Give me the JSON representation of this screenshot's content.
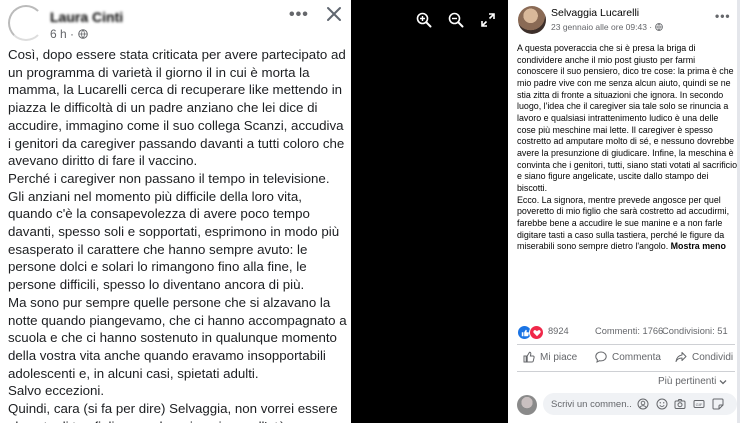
{
  "left_post": {
    "author": "Laura Cinti",
    "time": "6 h ·",
    "paragraphs": [
      "Così, dopo essere stata criticata per avere partecipato ad un programma di varietà il giorno il in cui è morta la mamma, la Lucarelli cerca di recuperare like mettendo in piazza le difficoltà di un padre anziano che lei dice di accudire, immagino come il suo collega Scanzi, accudiva i genitori da caregiver passando davanti a tutti coloro che avevano diritto di fare il vaccino.",
      "Perché i caregiver non passano il tempo in televisione.",
      "Gli anziani nel momento più difficile della loro vita, quando c'è la consapevolezza di avere poco tempo davanti, spesso soli e sopportati, esprimono in modo più esasperato il carattere che hanno sempre avuto: le persone dolci e solari lo rimangono fino alla fine, le persone difficili, spesso lo diventano ancora di più.",
      "Ma sono pur sempre quelle persone che si alzavano la notte quando piangevamo, che ci hanno accompagnato a scuola e che ci hanno sostenuto in qualunque momento della vostra vita anche quando eravamo insopportabili adolescenti e, in alcuni casi, spietati adulti.",
      "Salvo eccezioni.",
      "Quindi, cara (si fa per dire) Selvaggia, non vorrei essere al posto di tuo figlio quando arriverai a quell'età."
    ]
  },
  "right_panel": {
    "author": "Selvaggia Lucarelli",
    "date": "23 gennaio alle ore 09:43 ·",
    "paragraphs": [
      "A questa poveraccia che si è presa la briga di condividere anche il mio post giusto per farmi conoscere il suo pensiero, dico tre cose: la prima è che mio padre vive con me senza alcun aiuto, quindi se ne stia zitta di fronte a situazioni che ignora. In secondo luogo, l'idea che il caregiver sia tale solo se rinuncia a lavoro e qualsiasi intrattenimento ludico è una delle cose più meschine mai lette. Il caregiver è spesso costretto ad amputare molto di sé, e nessuno dovrebbe avere la presunzione di giudicare. Infine, la meschina è convinta che i genitori, tutti, siano stati votati al sacrificio e siano figure angelicate, uscite dallo stampo dei biscotti.",
      "Ecco. La signora, mentre prevede angosce per quel poveretto di mio figlio che sarà costretto ad accudirmi, farebbe bene a accudire le sue manine e a non farle digitare tasti a caso sulla tastiera, perché le figure da miserabili sono sempre dietro l'angolo."
    ],
    "show_less": "Mostra meno",
    "reaction_count": "8924",
    "comments": "Commenti: 1766",
    "shares": "Condivisioni: 51",
    "actions": {
      "like": "Mi piace",
      "comment": "Commenta",
      "share": "Condividi"
    },
    "sort": "Più pertinenti",
    "comment_placeholder": "Scrivi un commen..."
  },
  "colors": {
    "accent": "#1b74e4",
    "love": "#f0284a",
    "text_secondary": "#65676b",
    "viewer_bg": "#000000"
  }
}
